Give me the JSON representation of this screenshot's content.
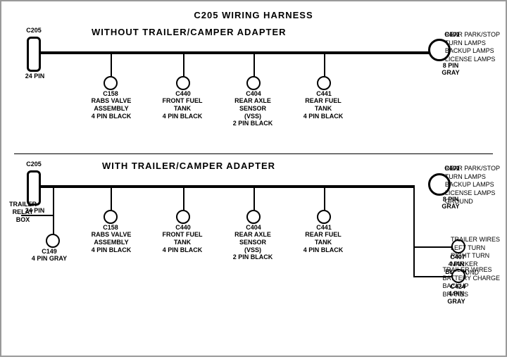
{
  "title": "C205 WIRING HARNESS",
  "section1": {
    "label": "WITHOUT  TRAILER/CAMPER  ADAPTER",
    "c205": {
      "id": "C205",
      "pin": "24 PIN"
    },
    "c401": {
      "id": "C401",
      "pin": "8 PIN",
      "color": "GRAY"
    },
    "c401_label": "REAR PARK/STOP\nTURN LAMPS\nBACKUP LAMPS\nLICENSE LAMPS",
    "connectors": [
      {
        "id": "C158",
        "label": "RABS VALVE\nASSEMBLY\n4 PIN BLACK"
      },
      {
        "id": "C440",
        "label": "FRONT FUEL\nTANK\n4 PIN BLACK"
      },
      {
        "id": "C404",
        "label": "REAR AXLE\nSENSOR\n(VSS)\n2 PIN BLACK"
      },
      {
        "id": "C441",
        "label": "REAR FUEL\nTANK\n4 PIN BLACK"
      }
    ]
  },
  "section2": {
    "label": "WITH  TRAILER/CAMPER  ADAPTER",
    "c205": {
      "id": "C205",
      "pin": "24 PIN"
    },
    "c401": {
      "id": "C401",
      "pin": "8 PIN",
      "color": "GRAY"
    },
    "c401_label": "REAR PARK/STOP\nTURN LAMPS\nBACKUP LAMPS\nLICENSE LAMPS\nGROUND",
    "trailer_relay": "TRAILER\nRELAY\nBOX",
    "c149": {
      "id": "C149",
      "label": "4 PIN GRAY"
    },
    "connectors": [
      {
        "id": "C158",
        "label": "RABS VALVE\nASSEMBLY\n4 PIN BLACK"
      },
      {
        "id": "C440",
        "label": "FRONT FUEL\nTANK\n4 PIN BLACK"
      },
      {
        "id": "C404",
        "label": "REAR AXLE\nSENSOR\n(VSS)\n2 PIN BLACK"
      },
      {
        "id": "C441",
        "label": "REAR FUEL\nTANK\n4 PIN BLACK"
      }
    ],
    "c407": {
      "id": "C407",
      "label": "4 PIN\nBLACK",
      "desc": "TRAILER WIRES\nLEFT TURN\nRIGHT TURN\nMARKER\nGROUND"
    },
    "c424": {
      "id": "C424",
      "label": "4 PIN\nGRAY",
      "desc": "TRAILER WIRES\nBATTERY CHARGE\nBACKUP\nBRAKES"
    }
  }
}
